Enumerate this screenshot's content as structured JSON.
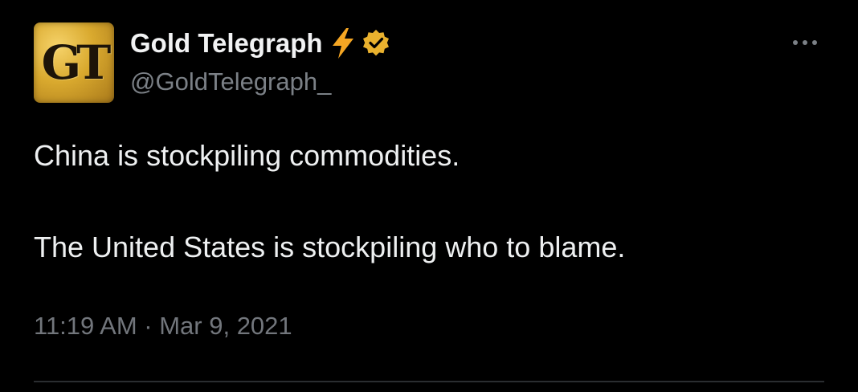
{
  "tweet": {
    "author": {
      "name": "Gold Telegraph",
      "handle": "@GoldTelegraph_",
      "avatar_monogram": "GT",
      "badges": [
        "lightning-bolt-icon",
        "verified-badge-icon"
      ]
    },
    "text_lines": [
      "China is stockpiling commodities.",
      "The United States is stockpiling who to blame."
    ],
    "timestamp": "11:19 AM · Mar 9, 2021",
    "menu_icon": "more-options-icon"
  },
  "colors": {
    "background": "#000000",
    "name_text": "#f1f2f3",
    "secondary_text": "#7b8086",
    "bolt": "#f5a623",
    "verified": "#e9b12e",
    "divider": "#2a2d30"
  }
}
